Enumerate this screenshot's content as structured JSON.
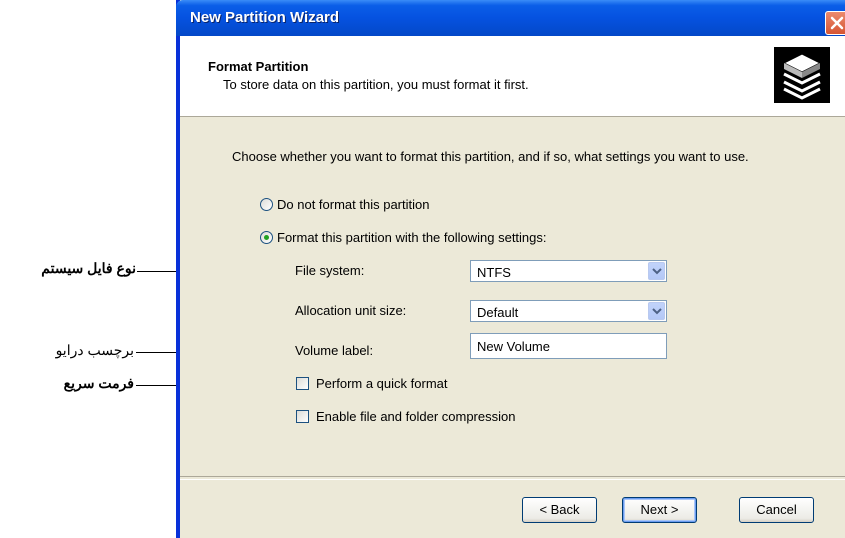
{
  "window": {
    "title": "New Partition Wizard"
  },
  "header": {
    "title": "Format Partition",
    "subtitle": "To store data on this partition, you must format it first.",
    "icon": "disk-stack-icon"
  },
  "intro": "Choose whether you want to format this partition, and if so, what settings you want to use.",
  "options": {
    "do_not_format": {
      "label": "Do not format this partition",
      "selected": false
    },
    "format_with": {
      "label": "Format this partition with the following settings:",
      "selected": true
    }
  },
  "settings": {
    "file_system": {
      "label": "File system:",
      "value": "NTFS"
    },
    "allocation": {
      "label": "Allocation unit size:",
      "value": "Default"
    },
    "volume_label": {
      "label": "Volume label:",
      "value": "New Volume"
    }
  },
  "checkboxes": {
    "quick_format": {
      "label": "Perform a quick format",
      "checked": false
    },
    "compression": {
      "label": "Enable file and folder compression",
      "checked": false
    }
  },
  "buttons": {
    "back": "< Back",
    "next": "Next >",
    "cancel": "Cancel"
  },
  "annotations": {
    "file_system": "نوع فایل سیستم",
    "volume_label": "برچسب درایو",
    "quick_format": "فرمت سریع"
  },
  "colors": {
    "titlebar": "#0552e0",
    "close": "#d65533",
    "dialog_bg": "#ece9d8",
    "radio_dot": "#21a121"
  }
}
